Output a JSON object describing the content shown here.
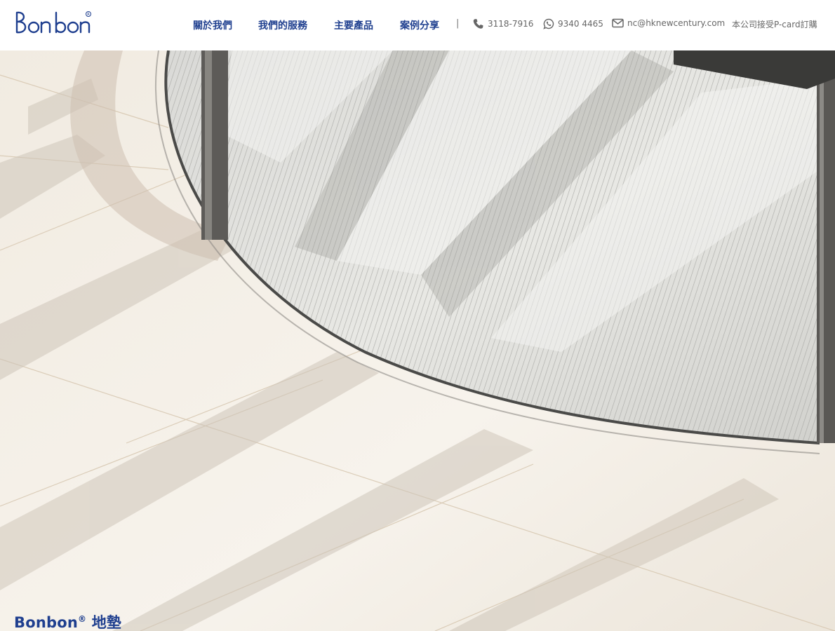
{
  "brand": {
    "name": "Bonbon",
    "registered": "®"
  },
  "nav": {
    "items": [
      {
        "label": "關於我們"
      },
      {
        "label": "我們的服務"
      },
      {
        "label": "主要產品"
      },
      {
        "label": "案例分享"
      }
    ],
    "separator": "|"
  },
  "contact": {
    "phone": "3118-7916",
    "whatsapp": "9340 4465",
    "email": "nc@hknewcentury.com",
    "notice": "本公司接受P-card訂購"
  },
  "hero": {
    "title_brand": "Bonbon",
    "title_mark": "®",
    "title_suffix": " 地墊"
  },
  "colors": {
    "brand_blue": "#1f3f8f",
    "contact_gray": "#666666"
  }
}
